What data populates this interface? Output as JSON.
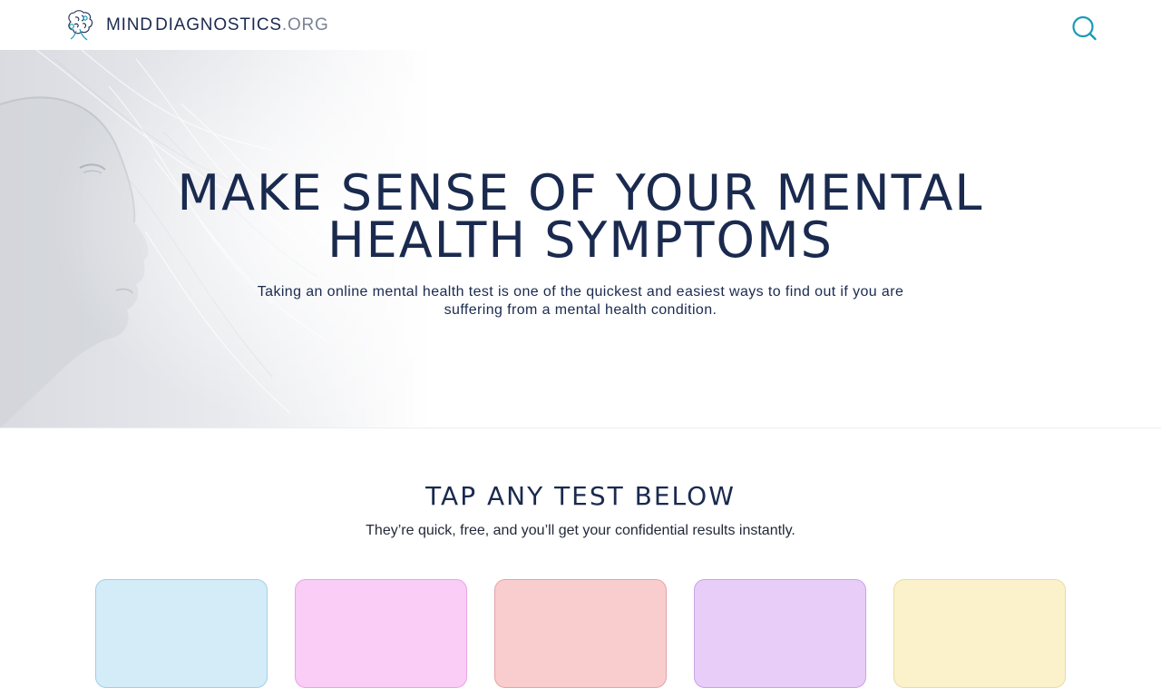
{
  "header": {
    "logo": {
      "mind": "MIND",
      "diagnostics": "DIAGNOSTICS",
      "org": ".ORG"
    },
    "search_icon": "search-icon"
  },
  "hero": {
    "title_line1": "MAKE SENSE OF YOUR MENTAL",
    "title_line2": "HEALTH SYMPTOMS",
    "subtitle_line1": "Taking an online mental health test is one of the quickest and easiest ways to find out if you are",
    "subtitle_line2": "suffering from a mental health condition."
  },
  "tests": {
    "title": "TAP ANY TEST BELOW",
    "subtitle": "They’re quick, free, and you’ll get your confidential results instantly.",
    "cards": [
      {
        "bg": "#d4ecf8",
        "border": "#9fd0ea"
      },
      {
        "bg": "#f9cdf6",
        "border": "#e6a6e2"
      },
      {
        "bg": "#f9cdce",
        "border": "#e3a5a8"
      },
      {
        "bg": "#e7cdf8",
        "border": "#c9a4e3"
      },
      {
        "bg": "#fbf1ca",
        "border": "#e9dca6"
      }
    ]
  },
  "colors": {
    "navy": "#1a2a4f",
    "accent": "#1a9bb8"
  }
}
